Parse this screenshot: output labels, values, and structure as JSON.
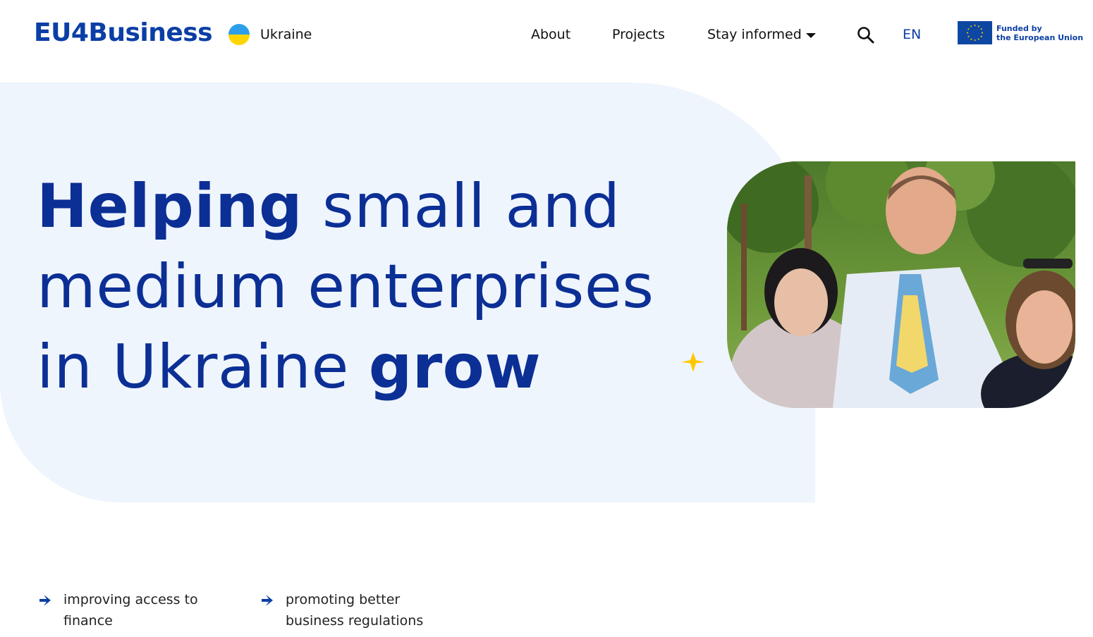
{
  "header": {
    "logo": "EU4Business",
    "country": "Ukraine",
    "nav": {
      "about": "About",
      "projects": "Projects",
      "stay_informed": "Stay informed"
    },
    "language": "EN",
    "eu_badge": {
      "line1": "Funded by",
      "line2": "the European Union"
    }
  },
  "hero": {
    "title_bold_1": "Helping",
    "title_regular_1": " small and medium enterprises in Ukraine ",
    "title_bold_2": "grow"
  },
  "bullets": [
    {
      "text": "improving access to finance"
    },
    {
      "text": "promoting better business regulations"
    }
  ],
  "colors": {
    "brand_blue": "#0b2f95",
    "hero_bg": "#eff5fd",
    "accent_yellow": "#ffd500",
    "ukraine_blue": "#2c9fe8"
  }
}
